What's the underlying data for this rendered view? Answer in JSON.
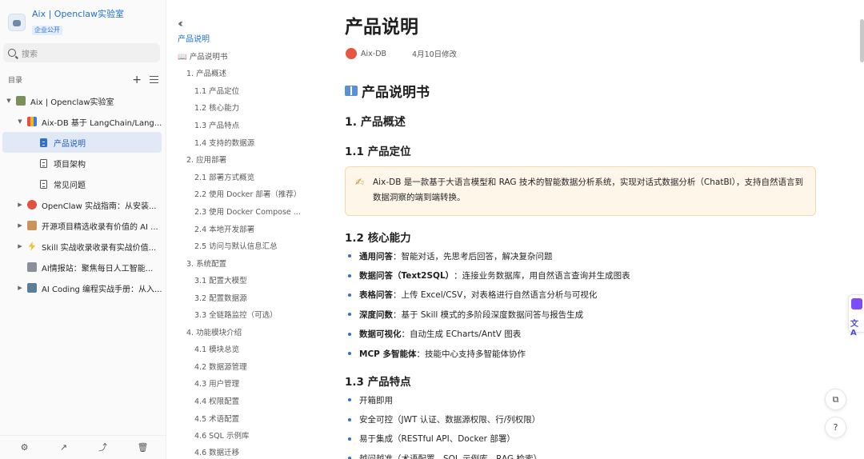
{
  "app": {
    "title": "Aix | Openclaw实验室",
    "badge": "企业公开"
  },
  "sidebar": {
    "search_placeholder": "搜索",
    "toc_label": "目录",
    "items": [
      {
        "label": "Aix | Openclaw实验室",
        "level": 0,
        "expanded": true,
        "icon": "books-icon"
      },
      {
        "label": "Aix-DB 基于 LangChain/Lang...",
        "level": 1,
        "expanded": true,
        "icon": "bar-chart-icon"
      },
      {
        "label": "产品说明",
        "level": 2,
        "active": true,
        "icon": "doc-icon"
      },
      {
        "label": "项目架构",
        "level": 2,
        "icon": "doc-icon"
      },
      {
        "label": "常见问题",
        "level": 2,
        "icon": "doc-icon"
      },
      {
        "label": "OpenClaw 实战指南：从安装...",
        "level": 1,
        "expanded": false,
        "icon": "lobster-icon"
      },
      {
        "label": "开源项目精选收录有价值的 AI ...",
        "level": 1,
        "expanded": false,
        "icon": "box-icon"
      },
      {
        "label": "Skill 实战收录收录有实战价值...",
        "level": 1,
        "expanded": false,
        "icon": "lightning-icon"
      },
      {
        "label": "AI情报站：聚焦每日人工智能...",
        "level": 1,
        "icon": "satellite-icon"
      },
      {
        "label": "AI Coding 编程实战手册：从入...",
        "level": 1,
        "expanded": false,
        "icon": "robot-icon"
      }
    ],
    "bottom_icons": [
      "settings-icon",
      "share-icon",
      "stats-icon",
      "trash-icon"
    ]
  },
  "outline": {
    "title": "产品说明",
    "items": [
      "📖 产品说明书",
      "1. 产品概述",
      "1.1 产品定位",
      "1.2 核心能力",
      "1.3 产品特点",
      "1.4 支持的数据源",
      "2. 应用部署",
      "2.1 部署方式概览",
      "2.2 使用 Docker 部署（推荐）",
      "2.3 使用 Docker Compose ...",
      "2.4 本地开发部署",
      "2.5 访问与默认信息汇总",
      "3. 系统配置",
      "3.1 配置大模型",
      "3.2 配置数据源",
      "3.3 全链路监控（可选）",
      "4. 功能模块介绍",
      "4.1 模块总览",
      "4.2 数据源管理",
      "4.3 用户管理",
      "4.4 权限配置",
      "4.5 术语配置",
      "4.6 SQL 示例库",
      "4.6 数据迁移"
    ]
  },
  "doc": {
    "title": "产品说明",
    "author": "Aix-DB",
    "modified": "4月10日修改",
    "h1": "产品说明书",
    "sec1": "1. 产品概述",
    "sec1_1": "1.1 产品定位",
    "callout": "Aix-DB 是一款基于大语言模型和 RAG 技术的智能数据分析系统，实现对话式数据分析（ChatBI），支持自然语言到数据洞察的端到端转换。",
    "sec1_2": "1.2 核心能力",
    "capabilities": [
      {
        "bold": "通用问答",
        "text": "：智能对话，先思考后回答，解决复杂问题"
      },
      {
        "bold": "数据问答（Text2SQL）",
        "text": "：连接业务数据库，用自然语言查询并生成图表"
      },
      {
        "bold": "表格问答",
        "text": "：上传 Excel/CSV，对表格进行自然语言分析与可视化"
      },
      {
        "bold": "深度问数",
        "text": "：基于 Skill 模式的多阶段深度数据问答与报告生成"
      },
      {
        "bold": "数据可视化",
        "text": "：自动生成 ECharts/AntV 图表"
      },
      {
        "bold": "MCP 多智能体",
        "text": "：技能中心支持多智能体协作"
      }
    ],
    "sec1_3": "1.3 产品特点",
    "features": [
      "开箱即用",
      "安全可控（JWT 认证、数据源权限、行/列权限）",
      "易于集成（RESTful API、Docker 部署）",
      "越问越准（术语配置、SQL 示例库、RAG 检索）"
    ]
  },
  "colors": {
    "accent": "#1f6fd6",
    "callout_bg": "#fef6e9",
    "active_bg": "#e1e9f7"
  }
}
